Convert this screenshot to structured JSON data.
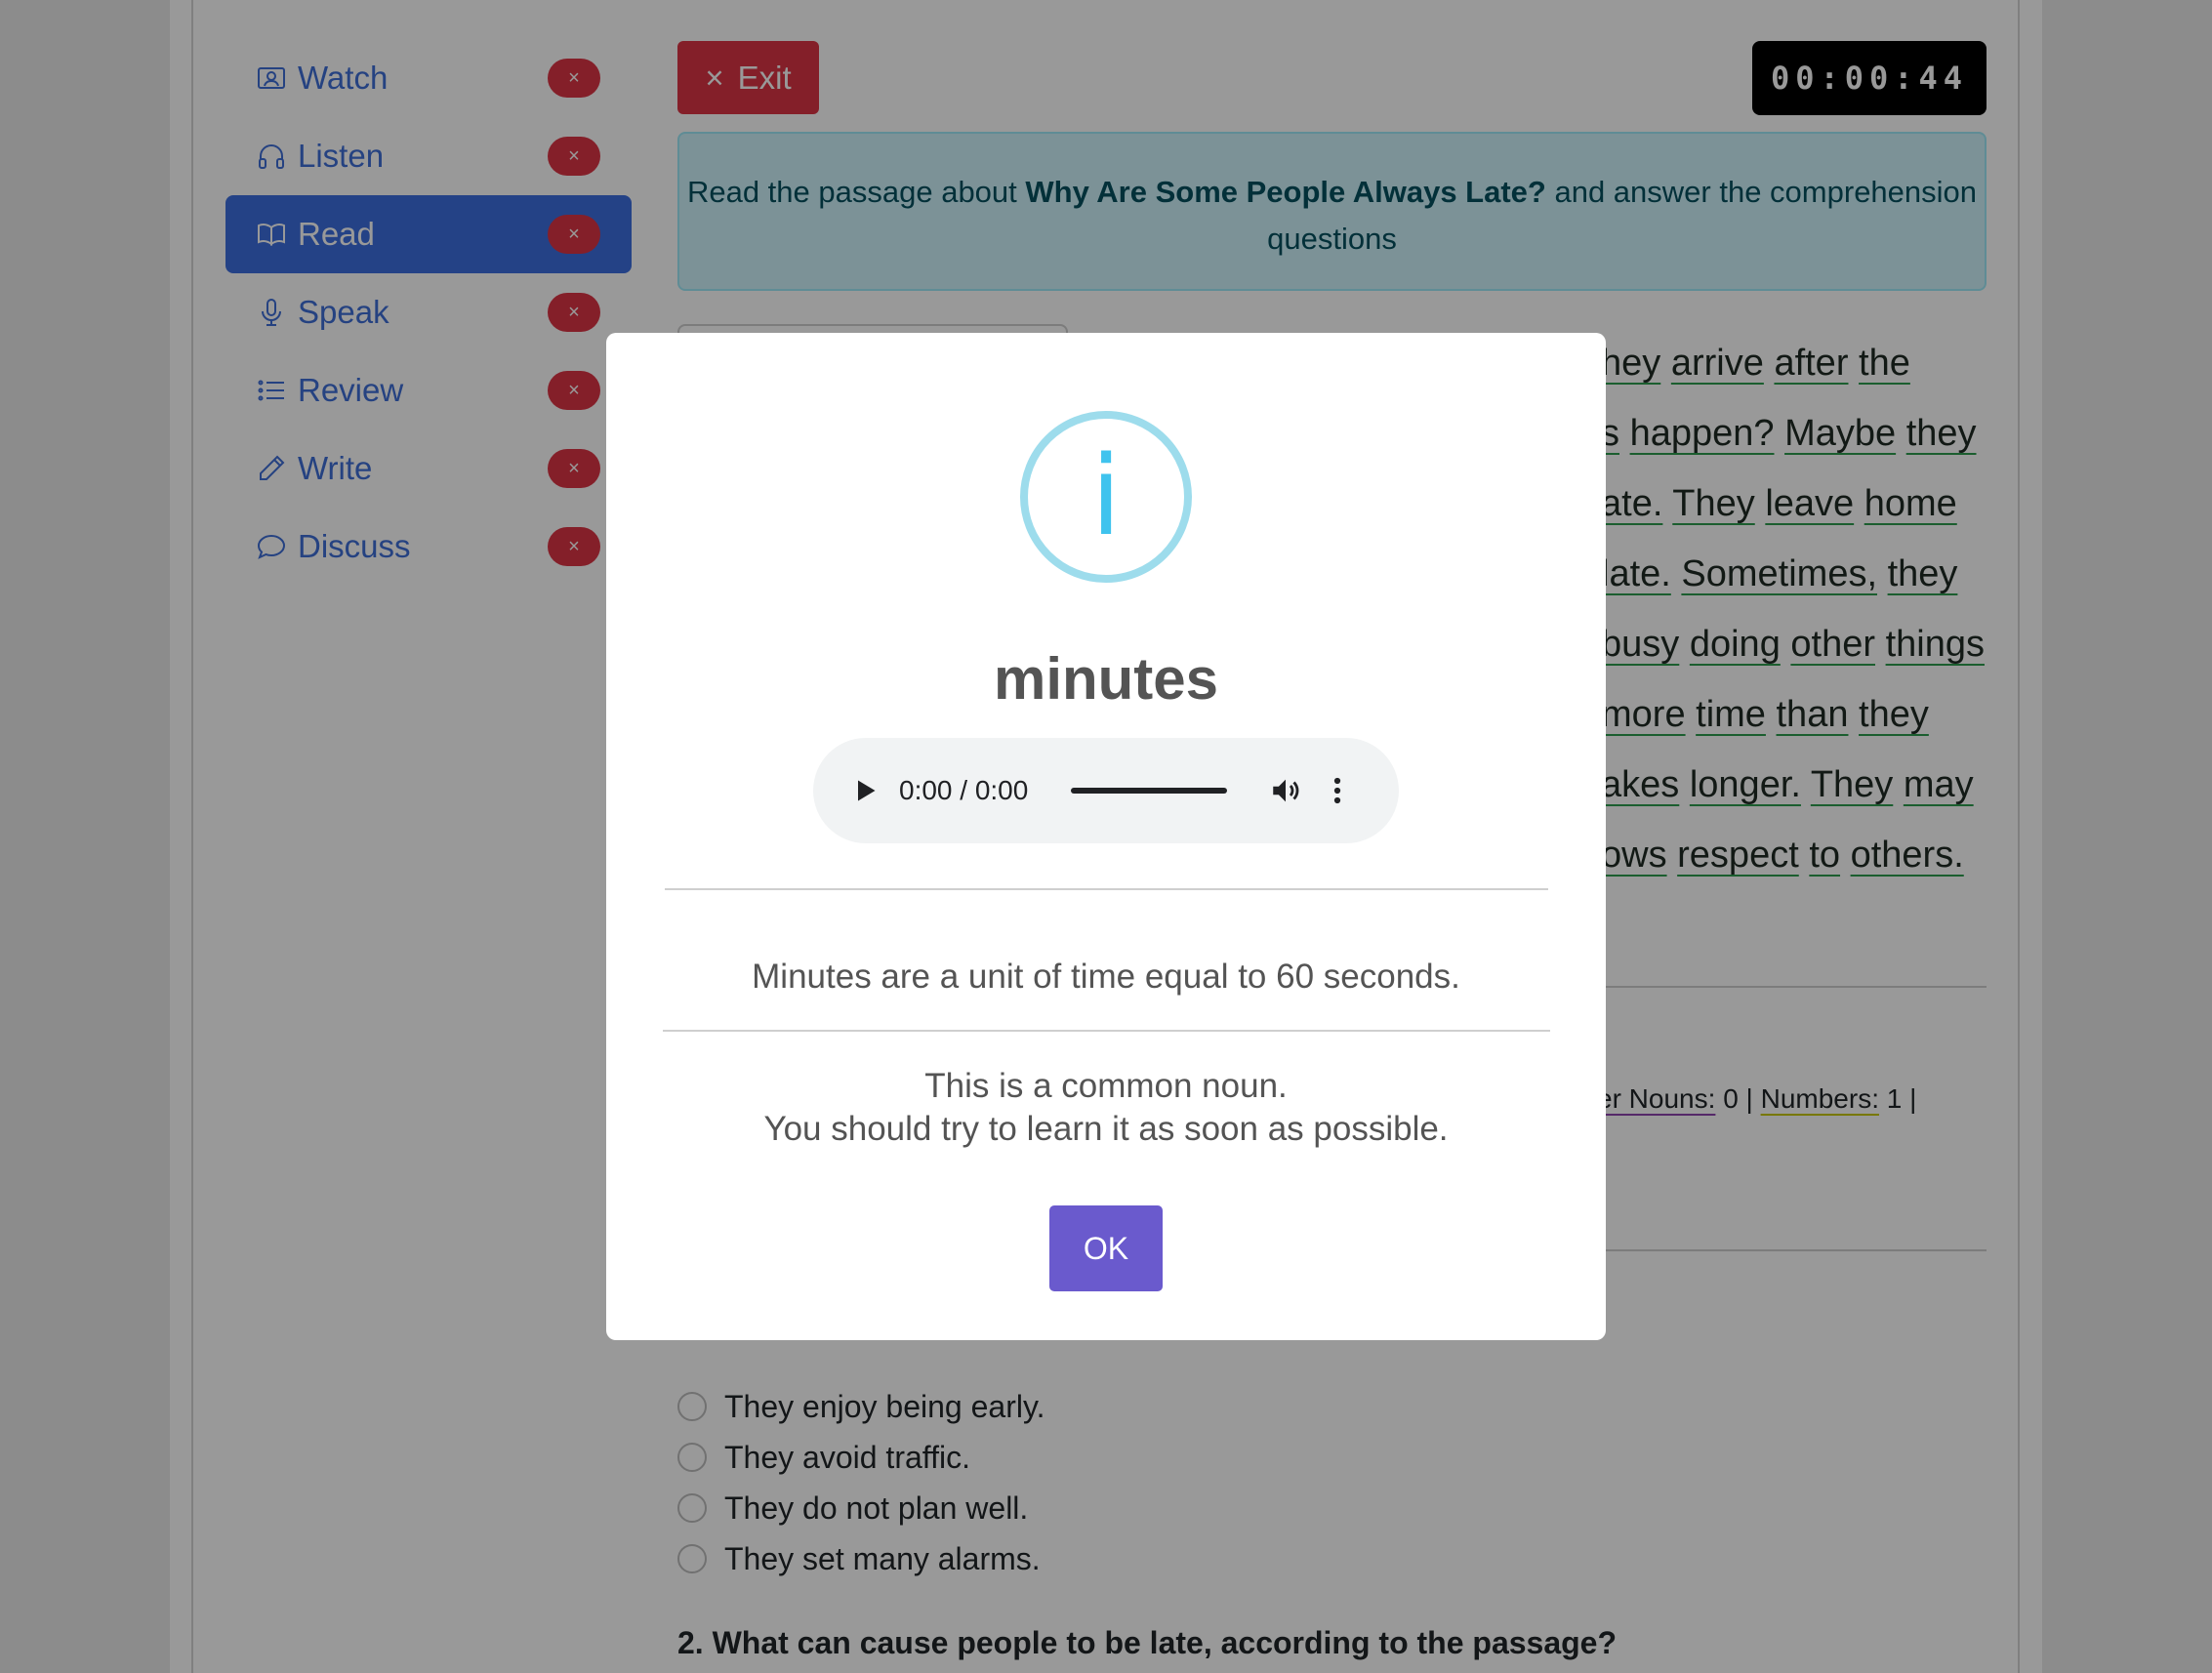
{
  "sidebar": {
    "items": [
      {
        "label": "Watch",
        "icon": "person-video-icon",
        "badge": "×",
        "active": false
      },
      {
        "label": "Listen",
        "icon": "headphones-icon",
        "badge": "×",
        "active": false
      },
      {
        "label": "Read",
        "icon": "book-icon",
        "badge": "×",
        "active": true
      },
      {
        "label": "Speak",
        "icon": "mic-icon",
        "badge": "×",
        "active": false
      },
      {
        "label": "Review",
        "icon": "list-icon",
        "badge": "×",
        "active": false
      },
      {
        "label": "Write",
        "icon": "pencil-icon",
        "badge": "×",
        "active": false
      },
      {
        "label": "Discuss",
        "icon": "chat-icon",
        "badge": "×",
        "active": false
      }
    ]
  },
  "toolbar": {
    "exit_icon": "×",
    "exit_label": "Exit",
    "timer": "00:00:44"
  },
  "instruction": {
    "prefix": "Read the passage about ",
    "title": "Why Are Some People Always Late?",
    "suffix": " and answer the comprehension questions"
  },
  "passage_fragments": [
    [
      "hey",
      "arrive",
      "after",
      "the"
    ],
    [
      "s",
      "happen?",
      "Maybe",
      "they"
    ],
    [
      "ate.",
      "They",
      "leave",
      "home"
    ],
    [
      "late.",
      "Sometimes,",
      "they"
    ],
    [
      "busy",
      "doing",
      "other",
      "things"
    ],
    [
      "more",
      "time",
      "than",
      "they"
    ],
    [
      "akes",
      "longer.",
      "They",
      "may"
    ],
    [
      "ows",
      "respect",
      "to",
      "others."
    ]
  ],
  "stats": {
    "proper_nouns_label": "er Nouns:",
    "proper_nouns_value": "0",
    "sep1": "|",
    "numbers_label": "Numbers:",
    "numbers_value": "1",
    "sep2": "|"
  },
  "quiz": {
    "options": [
      "They enjoy being early.",
      "They avoid traffic.",
      "They do not plan well.",
      "They set many alarms."
    ],
    "question2": "2. What can cause people to be late, according to the passage?"
  },
  "modal": {
    "icon": "i",
    "word": "minutes",
    "audio_time": "0:00 / 0:00",
    "definition": "Minutes are a unit of time equal to 60 seconds.",
    "note_line1": "This is a common noun.",
    "note_line2": "You should try to learn it as soon as possible.",
    "ok_label": "OK"
  },
  "colors": {
    "primary": "#3d6ee0",
    "danger": "#dc3545",
    "info_bg": "#cff4fc",
    "ok_button": "#6a5acd",
    "info_icon": "#3fc3ee"
  }
}
